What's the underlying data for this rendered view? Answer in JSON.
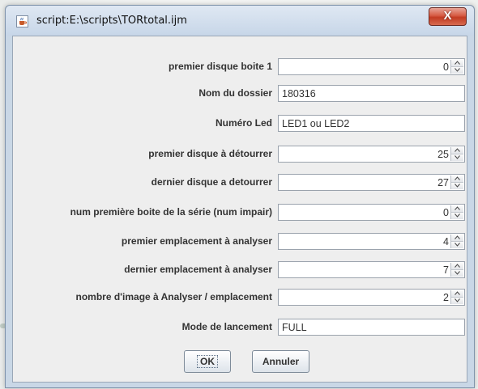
{
  "window": {
    "title": "script:E:\\scripts\\TORtotal.ijm",
    "close_label": "X"
  },
  "form": {
    "rows": [
      {
        "label": "premier disque boite 1",
        "type": "spinner",
        "value": "0"
      },
      {
        "label": "Nom du dossier",
        "type": "text",
        "value": "180316"
      },
      {
        "label": "Numéro Led",
        "type": "text",
        "value": "LED1 ou LED2"
      },
      {
        "label": "premier disque à détourrer",
        "type": "spinner",
        "value": "25"
      },
      {
        "label": "dernier disque a detourrer",
        "type": "spinner",
        "value": "27"
      },
      {
        "label": "num première boite de la série (num impair)",
        "type": "spinner",
        "value": "0"
      },
      {
        "label": "premier emplacement à analyser",
        "type": "spinner",
        "value": "4"
      },
      {
        "label": "dernier emplacement à analyser",
        "type": "spinner",
        "value": "7"
      },
      {
        "label": "nombre d'image à Analyser / emplacement",
        "type": "spinner",
        "value": "2"
      },
      {
        "label": "Mode de lancement",
        "type": "text",
        "value": "FULL"
      }
    ]
  },
  "buttons": {
    "ok": "OK",
    "cancel": "Annuler"
  },
  "icons": {
    "app": "java-cup-icon",
    "close": "close-icon",
    "spin_up": "arrow-up-icon",
    "spin_down": "arrow-down-icon"
  },
  "colors": {
    "title_bar": "#c9d7e6",
    "close_button": "#c94a35",
    "panel": "#eeeeee"
  }
}
